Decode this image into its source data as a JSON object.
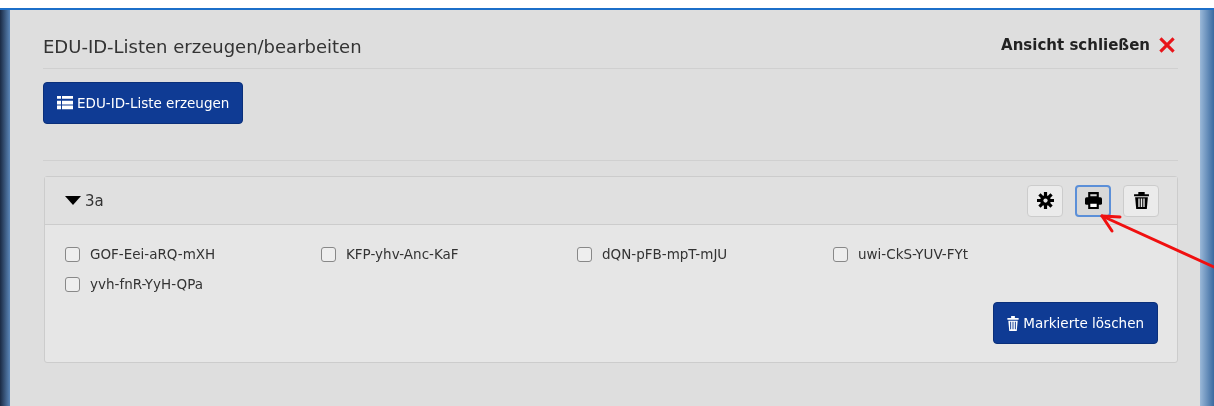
{
  "header": {
    "title": "EDU-ID-Listen erzeugen/bearbeiten",
    "close_label": "Ansicht schließen"
  },
  "create_button": {
    "label": "EDU-ID-Liste erzeugen"
  },
  "list_card": {
    "name": "3a",
    "expanded": true,
    "tools": [
      {
        "kind": "settings",
        "focused": false
      },
      {
        "kind": "print",
        "focused": true
      },
      {
        "kind": "delete",
        "focused": false
      }
    ],
    "items": [
      {
        "label": "GOF-Eei-aRQ-mXH",
        "checked": false
      },
      {
        "label": "KFP-yhv-Anc-KaF",
        "checked": false
      },
      {
        "label": "dQN-pFB-mpT-mJU",
        "checked": false
      },
      {
        "label": "uwi-CkS-YUV-FYt",
        "checked": false
      },
      {
        "label": "yvh-fnR-YyH-QPa",
        "checked": false
      }
    ],
    "delete_button": {
      "label": "Markierte löschen"
    }
  },
  "annotation": {
    "kind": "arrow"
  }
}
